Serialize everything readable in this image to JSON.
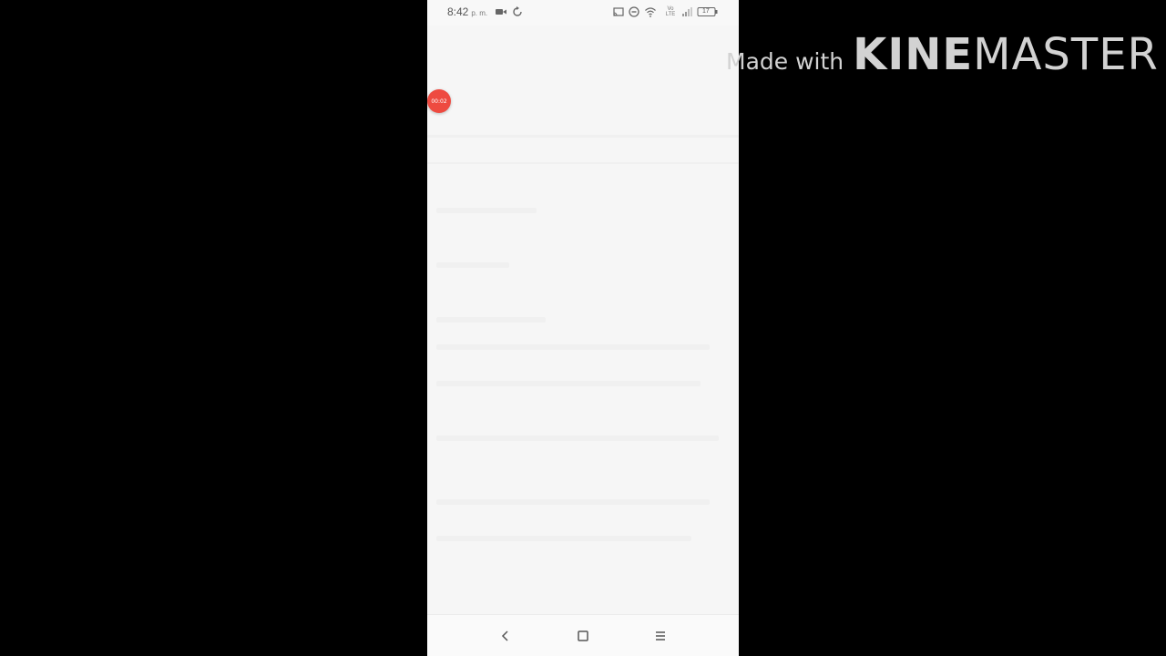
{
  "status_bar": {
    "time": "8:42",
    "ampm": "p. m.",
    "battery": "17",
    "network": "Vo LTE",
    "icons": [
      "video-camera-icon",
      "sync-icon",
      "cast-icon",
      "do-not-disturb-icon",
      "wifi-icon",
      "volte-icon",
      "signal-icon",
      "battery-icon"
    ]
  },
  "record_bubble": {
    "label": "00:02",
    "color": "#ee4a40"
  },
  "nav_bar": {
    "icons": [
      "back-icon",
      "home-icon",
      "menu-icon"
    ]
  },
  "watermark": {
    "prefix": "Made with",
    "brand_bold": "KINE",
    "brand_light": "MASTER"
  },
  "colors": {
    "background": "#000000",
    "screen": "#f7f7f7",
    "accent": "#ee4a40"
  }
}
